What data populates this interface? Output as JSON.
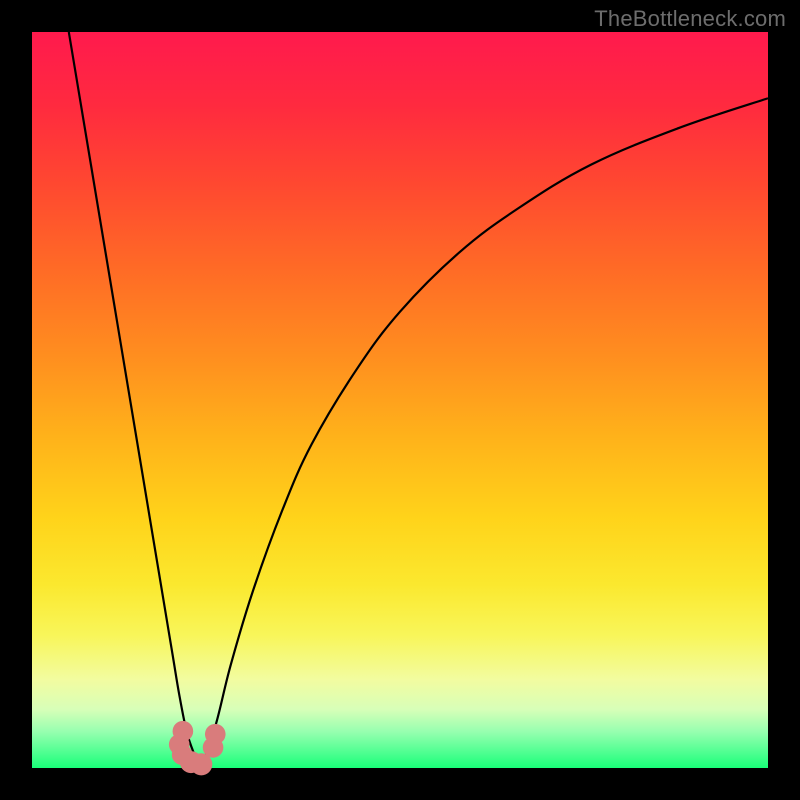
{
  "watermark": "TheBottleneck.com",
  "colors": {
    "frame": "#000000",
    "curve": "#000000",
    "marker": "#d97c7c",
    "gradient_top": "#ff1a4d",
    "gradient_bottom": "#19ff78"
  },
  "chart_data": {
    "type": "line",
    "title": "",
    "xlabel": "",
    "ylabel": "",
    "xlim": [
      0,
      100
    ],
    "ylim": [
      0,
      100
    ],
    "annotations": [
      "TheBottleneck.com"
    ],
    "grid": false,
    "legend": false,
    "series": [
      {
        "name": "left-branch",
        "x": [
          5,
          7,
          9,
          11,
          13,
          15,
          17,
          19,
          20,
          21,
          22,
          23
        ],
        "y": [
          100,
          88,
          76,
          64,
          52,
          40,
          28,
          16,
          10,
          5,
          2,
          0
        ]
      },
      {
        "name": "right-branch",
        "x": [
          23,
          25,
          27,
          30,
          34,
          38,
          44,
          50,
          58,
          66,
          76,
          88,
          100
        ],
        "y": [
          0,
          6,
          14,
          24,
          35,
          44,
          54,
          62,
          70,
          76,
          82,
          87,
          91
        ]
      }
    ],
    "markers": [
      {
        "x": 20.5,
        "y": 5.0,
        "r": 1.4
      },
      {
        "x": 20.0,
        "y": 3.2,
        "r": 1.4
      },
      {
        "x": 20.4,
        "y": 1.8,
        "r": 1.4
      },
      {
        "x": 21.6,
        "y": 0.8,
        "r": 1.5
      },
      {
        "x": 23.0,
        "y": 0.5,
        "r": 1.5
      },
      {
        "x": 24.6,
        "y": 2.8,
        "r": 1.4
      },
      {
        "x": 24.9,
        "y": 4.6,
        "r": 1.4
      }
    ]
  }
}
